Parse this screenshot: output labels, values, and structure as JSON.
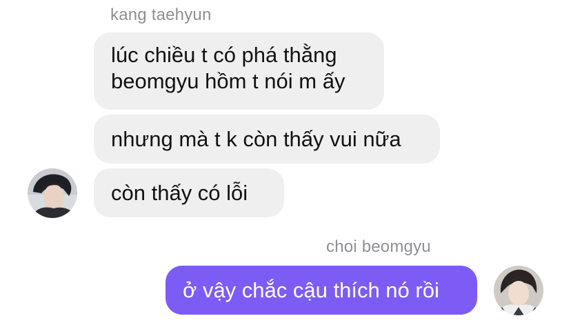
{
  "received": {
    "sender": "kang taehyun",
    "messages": [
      {
        "line1": "lúc chiều t có phá thằng",
        "line2": "beomgyu hồm t nói m ấy"
      },
      {
        "text": "nhưng mà t k còn thấy vui nữa"
      },
      {
        "text": "còn thấy có lỗi"
      }
    ],
    "avatar_icon": "avatar-taehyun-photo"
  },
  "sent": {
    "sender": "choi beomgyu",
    "messages": [
      {
        "text": "ở vậy chắc cậu thích nó rồi"
      }
    ],
    "avatar_icon": "avatar-beomgyu-photo",
    "bubble_color": "#7c5cf5"
  },
  "colors": {
    "incoming_bubble": "#efefef",
    "name_label": "#8e8e93",
    "text": "#111111"
  }
}
